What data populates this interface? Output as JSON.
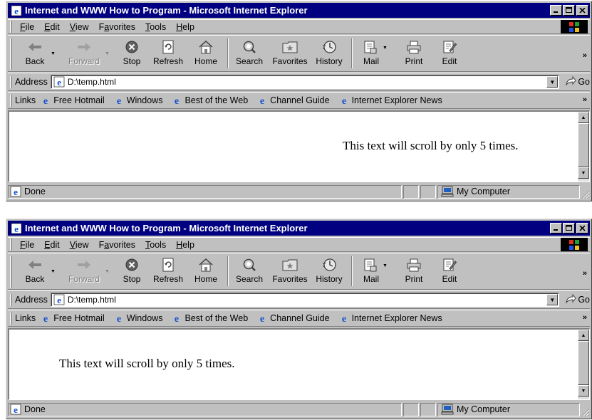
{
  "windows": [
    {
      "title": "Internet and WWW How to Program - Microsoft Internet Explorer",
      "menu": [
        "File",
        "Edit",
        "View",
        "Favorites",
        "Tools",
        "Help"
      ],
      "menu_accel": [
        "F",
        "E",
        "V",
        "a",
        "T",
        "H"
      ],
      "toolbar": [
        "Back",
        "Forward",
        "Stop",
        "Refresh",
        "Home",
        "Search",
        "Favorites",
        "History",
        "Mail",
        "Print",
        "Edit"
      ],
      "address_label": "Address",
      "address_value": "D:\\temp.html",
      "go_label": "Go",
      "links_label": "Links",
      "links": [
        "Free Hotmail",
        "Windows",
        "Best of the Web",
        "Channel Guide",
        "Internet Explorer News"
      ],
      "marquee_text": "This text will scroll by only 5 times.",
      "status_text": "Done",
      "zone_text": "My Computer"
    },
    {
      "title": "Internet and WWW How to Program - Microsoft Internet Explorer",
      "menu": [
        "File",
        "Edit",
        "View",
        "Favorites",
        "Tools",
        "Help"
      ],
      "menu_accel": [
        "F",
        "E",
        "V",
        "a",
        "T",
        "H"
      ],
      "toolbar": [
        "Back",
        "Forward",
        "Stop",
        "Refresh",
        "Home",
        "Search",
        "Favorites",
        "History",
        "Mail",
        "Print",
        "Edit"
      ],
      "address_label": "Address",
      "address_value": "D:\\temp.html",
      "go_label": "Go",
      "links_label": "Links",
      "links": [
        "Free Hotmail",
        "Windows",
        "Best of the Web",
        "Channel Guide",
        "Internet Explorer News"
      ],
      "marquee_text": "This text will scroll by only 5 times.",
      "status_text": "Done",
      "zone_text": "My Computer"
    }
  ],
  "colors": {
    "titlebar": "#000080",
    "chrome": "#c0c0c0",
    "content_bg": "#ffffff"
  },
  "icons": {
    "toolbar": [
      "back-arrow-icon",
      "forward-arrow-icon",
      "stop-icon",
      "refresh-icon",
      "home-icon",
      "search-icon",
      "favorites-icon",
      "history-icon",
      "mail-icon",
      "print-icon",
      "edit-icon"
    ],
    "page": "ie-page-icon",
    "zone": "my-computer-icon",
    "logo": "windows-logo-icon"
  }
}
